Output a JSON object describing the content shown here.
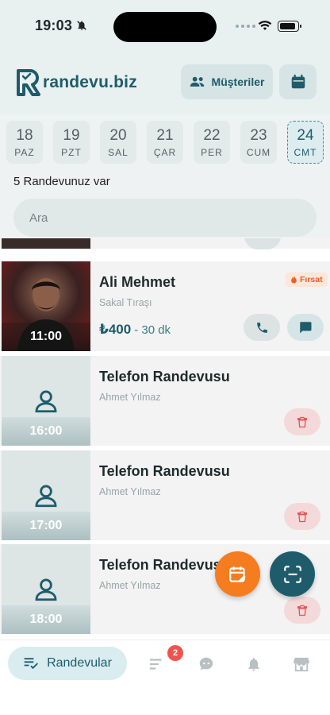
{
  "status": {
    "time": "19:03"
  },
  "header": {
    "logo_text": "randevu.biz",
    "customers_label": "Müşteriler"
  },
  "days": [
    {
      "num": "18",
      "label": "PAZ",
      "selected": false
    },
    {
      "num": "19",
      "label": "PZT",
      "selected": false
    },
    {
      "num": "20",
      "label": "SAL",
      "selected": false
    },
    {
      "num": "21",
      "label": "ÇAR",
      "selected": false
    },
    {
      "num": "22",
      "label": "PER",
      "selected": false
    },
    {
      "num": "23",
      "label": "CUM",
      "selected": false
    },
    {
      "num": "24",
      "label": "CMT",
      "selected": true
    }
  ],
  "summary": "5 Randevunuz var",
  "search": {
    "placeholder": "Ara"
  },
  "appointments": [
    {
      "time": "11:00",
      "name": "Ali Mehmet",
      "service": "Sakal Tıraşı",
      "price": "₺400",
      "duration": "- 30 dk",
      "badge": "Fırsat"
    },
    {
      "time": "16:00",
      "name": "Telefon Randevusu",
      "staff": "Ahmet Yılmaz"
    },
    {
      "time": "17:00",
      "name": "Telefon Randevusu",
      "staff": "Ahmet Yılmaz"
    },
    {
      "time": "18:00",
      "name": "Telefon Randevusu",
      "staff": "Ahmet Yılmaz"
    }
  ],
  "nav": {
    "active_label": "Randevular",
    "queue_badge": "2"
  },
  "colors": {
    "brand": "#1e5c6b",
    "accent": "#f57c1f",
    "danger": "#e05555",
    "badge_bg": "#fde6da"
  }
}
